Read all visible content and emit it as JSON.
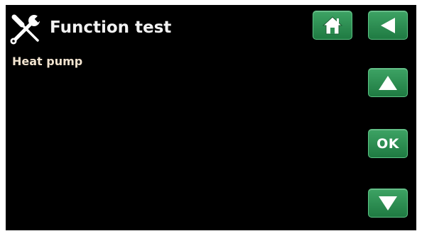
{
  "header": {
    "title": "Function test",
    "title_icon": "wrench-screwdriver-icon"
  },
  "menu": {
    "items": [
      {
        "label": "Heat pump"
      }
    ]
  },
  "buttons": {
    "home_icon": "home-icon",
    "back_icon": "back-arrow-icon",
    "up_icon": "up-arrow-icon",
    "ok_label": "OK",
    "down_icon": "down-arrow-icon"
  },
  "colors": {
    "background": "#000000",
    "button_green": "#2e8f53",
    "menu_text": "#f1e3cf"
  }
}
